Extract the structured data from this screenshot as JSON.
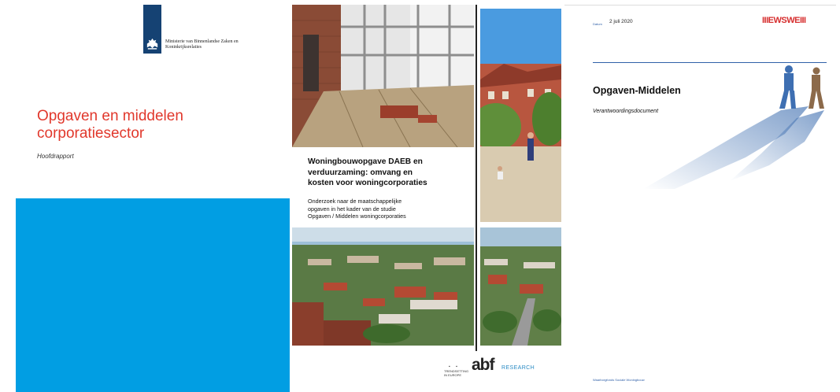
{
  "cover1": {
    "ministry_line1": "Ministerie van Binnenlandse Zaken en",
    "ministry_line2": "Koninkrijksrelaties",
    "title_line1": "Opgaven en middelen",
    "title_line2": "corporatiesector",
    "subtitle": "Hoofdrapport",
    "colors": {
      "title": "#e1382c",
      "band": "#019ee3",
      "logo_bar": "#154273"
    },
    "icon": "lion-crest-icon"
  },
  "cover2": {
    "title_line1": "Woningbouwopgave DAEB en",
    "title_line2": "verduurzaming: omvang en",
    "title_line3": "kosten voor woningcorporaties",
    "desc_line1": "Onderzoek naar de maatschappelijke",
    "desc_line2": "opgaven in het kader van de studie",
    "desc_line3": "Opgaven / Middelen woningcorporaties",
    "small_line1": "TRENDSETTING",
    "small_line2": "IN EUROPE",
    "brand": "abf",
    "brand_suffix": "RESEARCH",
    "colors": {
      "research": "#2a8bc4"
    }
  },
  "cover3": {
    "date_label": "Datum",
    "date": "2 juli 2020",
    "logo": "IIIEWSWEIII",
    "title": "Opgaven-Middelen",
    "subtitle": "Verantwoordingsdocument",
    "footer": "Waarborgfonds Sociale Woningbouw",
    "colors": {
      "logo": "#d62e2e",
      "accent": "#3060a8"
    }
  }
}
